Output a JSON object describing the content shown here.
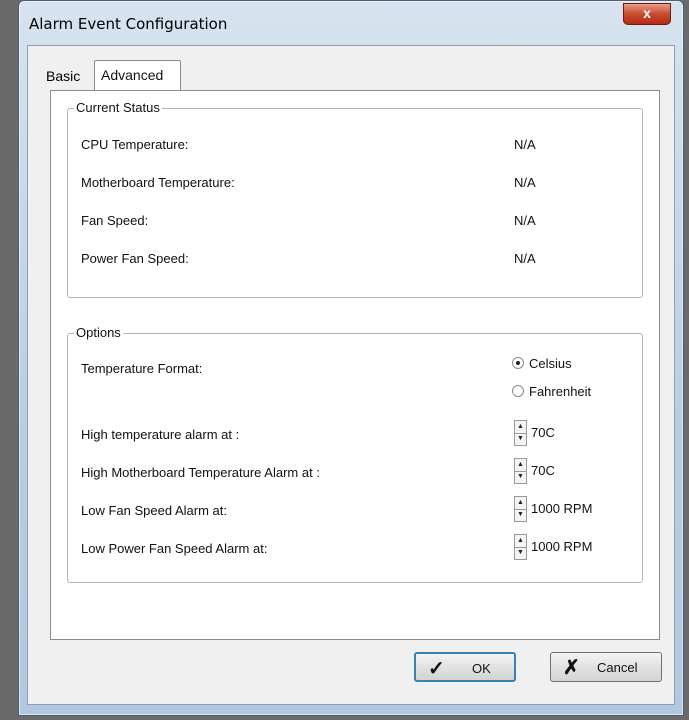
{
  "window": {
    "title": "Alarm Event Configuration",
    "close_glyph": "x"
  },
  "tabs": [
    {
      "label": "Basic",
      "selected": false
    },
    {
      "label": "Advanced",
      "selected": true
    }
  ],
  "current_status": {
    "title": "Current Status",
    "rows": [
      {
        "label": "CPU Temperature:",
        "value": "N/A"
      },
      {
        "label": "Motherboard Temperature:",
        "value": "N/A"
      },
      {
        "label": "Fan Speed:",
        "value": "N/A"
      },
      {
        "label": "Power Fan Speed:",
        "value": "N/A"
      }
    ]
  },
  "options": {
    "title": "Options",
    "temperature_format": {
      "label": "Temperature Format:",
      "choices": [
        {
          "label": "Celsius",
          "checked": true
        },
        {
          "label": "Fahrenheit",
          "checked": false
        }
      ]
    },
    "alarms": [
      {
        "label": "High temperature alarm at :",
        "value": "70C"
      },
      {
        "label": "High Motherboard Temperature Alarm at :",
        "value": "70C"
      },
      {
        "label": "Low Fan Speed Alarm at:",
        "value": "1000 RPM"
      },
      {
        "label": "Low Power Fan Speed Alarm at:",
        "value": "1000 RPM"
      }
    ]
  },
  "buttons": {
    "ok": {
      "label": "OK",
      "icon": "checkmark-icon",
      "glyph": "✓"
    },
    "cancel": {
      "label": "Cancel",
      "icon": "x-icon",
      "glyph": "✗"
    }
  },
  "colors": {
    "close_button": "#c94a31",
    "focus_border": "#3c7fb1"
  }
}
